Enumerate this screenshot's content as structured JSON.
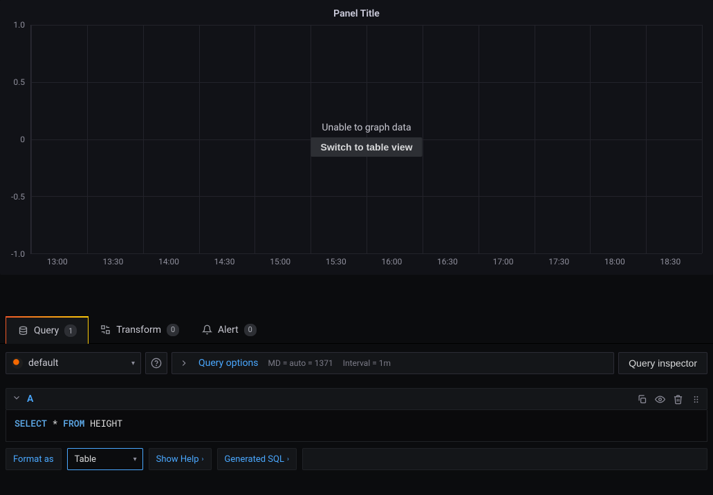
{
  "panel": {
    "title": "Panel Title",
    "error_text": "Unable to graph data",
    "switch_button": "Switch to table view"
  },
  "chart_data": {
    "type": "line",
    "series": [],
    "x_ticks": [
      "13:00",
      "13:30",
      "14:00",
      "14:30",
      "15:00",
      "15:30",
      "16:00",
      "16:30",
      "17:00",
      "17:30",
      "18:00",
      "18:30"
    ],
    "y_ticks": [
      "-1.0",
      "-0.5",
      "0",
      "0.5",
      "1.0"
    ],
    "ylim": [
      -1.0,
      1.0
    ],
    "title": "Panel Title",
    "xlabel": "",
    "ylabel": ""
  },
  "tabs": {
    "query": {
      "label": "Query",
      "count": "1"
    },
    "transform": {
      "label": "Transform",
      "count": "0"
    },
    "alert": {
      "label": "Alert",
      "count": "0"
    }
  },
  "datasource": {
    "name": "default"
  },
  "query_options": {
    "label": "Query options",
    "md_label": "MD = auto = 1371",
    "interval_label": "Interval = 1m"
  },
  "inspector_button": "Query inspector",
  "query_row": {
    "letter": "A",
    "sql": {
      "select": "SELECT",
      "star": "*",
      "from": "FROM",
      "table": "HEIGHT"
    }
  },
  "format": {
    "label": "Format as",
    "selected": "Table",
    "show_help": "Show Help",
    "generated_sql": "Generated SQL"
  }
}
